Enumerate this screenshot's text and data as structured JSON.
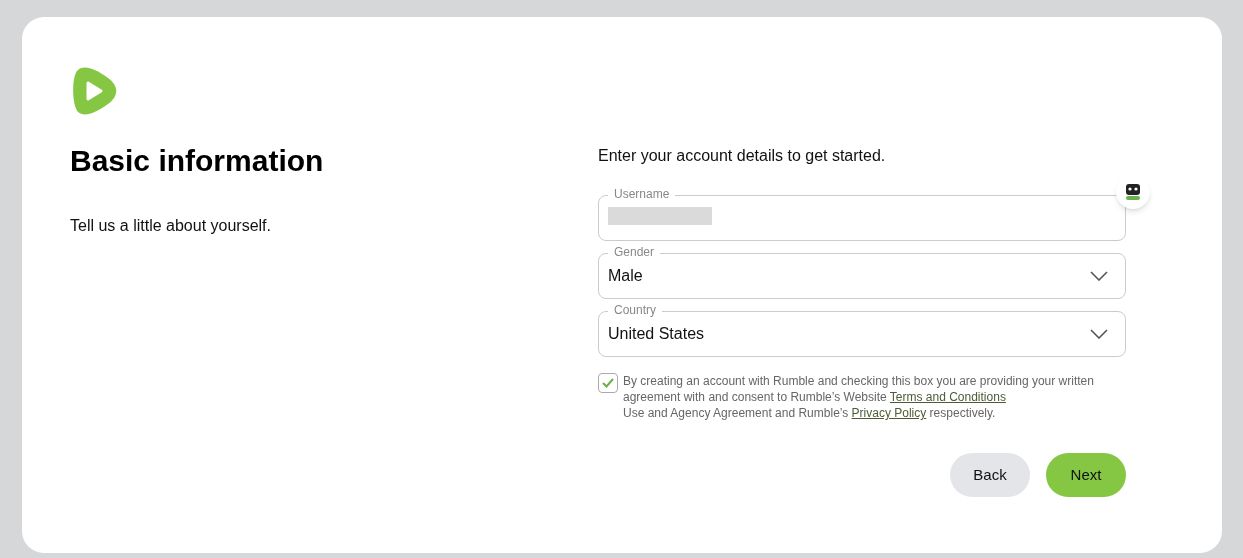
{
  "heading": "Basic information",
  "subheading": "Tell us a little about yourself.",
  "form": {
    "intro": "Enter your account details to get started.",
    "fields": [
      {
        "kind": "text",
        "label": "Username",
        "redacted": true
      },
      {
        "kind": "select",
        "label": "Gender",
        "value": "Male"
      },
      {
        "kind": "select",
        "label": "Country",
        "value": "United States"
      }
    ],
    "consent": {
      "checked": true,
      "lines": [
        [
          {
            "kind": "text",
            "text": "By creating an account with Rumble and checking this box you are providing your written"
          }
        ],
        [
          {
            "kind": "text",
            "text": "agreement with and consent to Rumble’s Website "
          },
          {
            "kind": "link",
            "text": "Terms and Conditions"
          }
        ],
        [
          {
            "kind": "text",
            "text": "Use and Agency Agreement and Rumble’s "
          },
          {
            "kind": "link",
            "text": "Privacy Policy"
          },
          {
            "kind": "text",
            "text": " respectively."
          }
        ]
      ]
    },
    "buttons": [
      {
        "kind": "secondary",
        "label": "Back"
      },
      {
        "kind": "primary",
        "label": "Next"
      }
    ]
  }
}
